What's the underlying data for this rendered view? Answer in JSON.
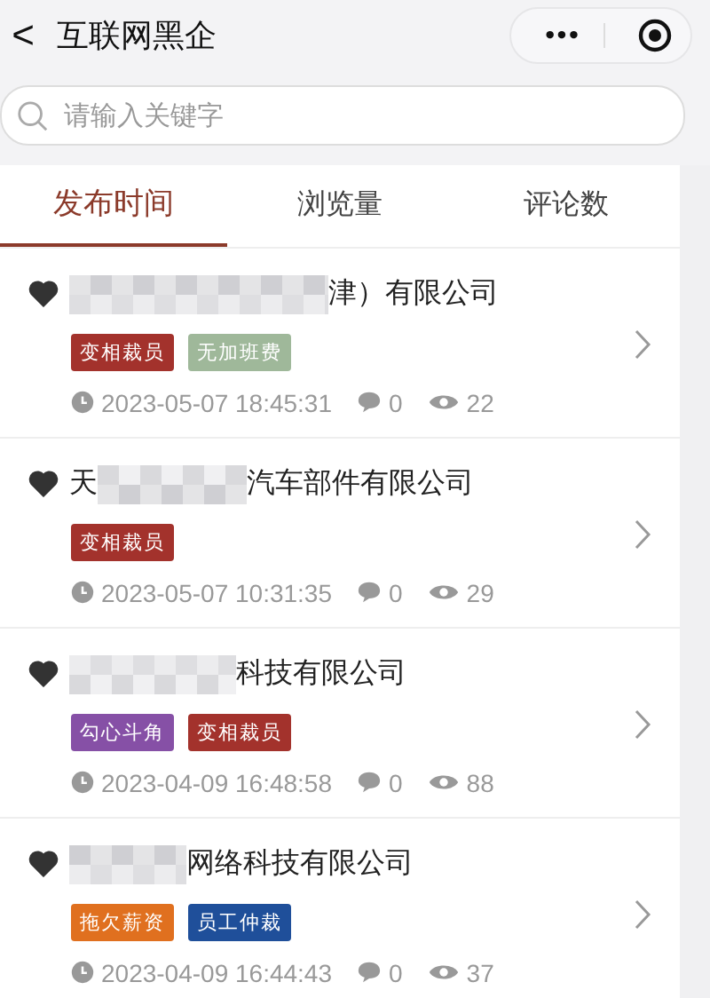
{
  "nav": {
    "back": "<",
    "title": "互联网黑企",
    "more": "•••"
  },
  "search": {
    "placeholder": "请输入关键字"
  },
  "tabs": [
    {
      "label": "发布时间",
      "selected": true
    },
    {
      "label": "浏览量",
      "selected": false
    },
    {
      "label": "评论数",
      "selected": false
    }
  ],
  "posts": [
    {
      "favorite": true,
      "name": [
        {
          "kind": "mosaic"
        },
        {
          "kind": "text",
          "text": "津）有限公司"
        }
      ],
      "tags": [
        {
          "label": "变相裁员",
          "color": "#a3322c"
        },
        {
          "label": "无加班费",
          "color": "#9fb89a"
        }
      ],
      "time": "2023-05-07 18:45:31",
      "comments": "0",
      "views": "22"
    },
    {
      "favorite": true,
      "name": [
        {
          "kind": "text",
          "text": "天"
        },
        {
          "kind": "mosaic"
        },
        {
          "kind": "text",
          "text": "汽车部件有限公司"
        }
      ],
      "tags": [
        {
          "label": "变相裁员",
          "color": "#a3322c"
        }
      ],
      "time": "2023-05-07 10:31:35",
      "comments": "0",
      "views": "29"
    },
    {
      "favorite": true,
      "name": [
        {
          "kind": "mosaic"
        },
        {
          "kind": "text",
          "text": "科技有限公司"
        }
      ],
      "tags": [
        {
          "label": "勾心斗角",
          "color": "#8650a6"
        },
        {
          "label": "变相裁员",
          "color": "#a3322c"
        }
      ],
      "time": "2023-04-09 16:48:58",
      "comments": "0",
      "views": "88"
    },
    {
      "favorite": true,
      "name": [
        {
          "kind": "mosaic"
        },
        {
          "kind": "text",
          "text": "网络科技有限公司"
        }
      ],
      "tags": [
        {
          "label": "拖欠薪资",
          "color": "#e0701f"
        },
        {
          "label": "员工仲裁",
          "color": "#1f4f9a"
        }
      ],
      "time": "2023-04-09 16:44:43",
      "comments": "0",
      "views": "37"
    }
  ]
}
